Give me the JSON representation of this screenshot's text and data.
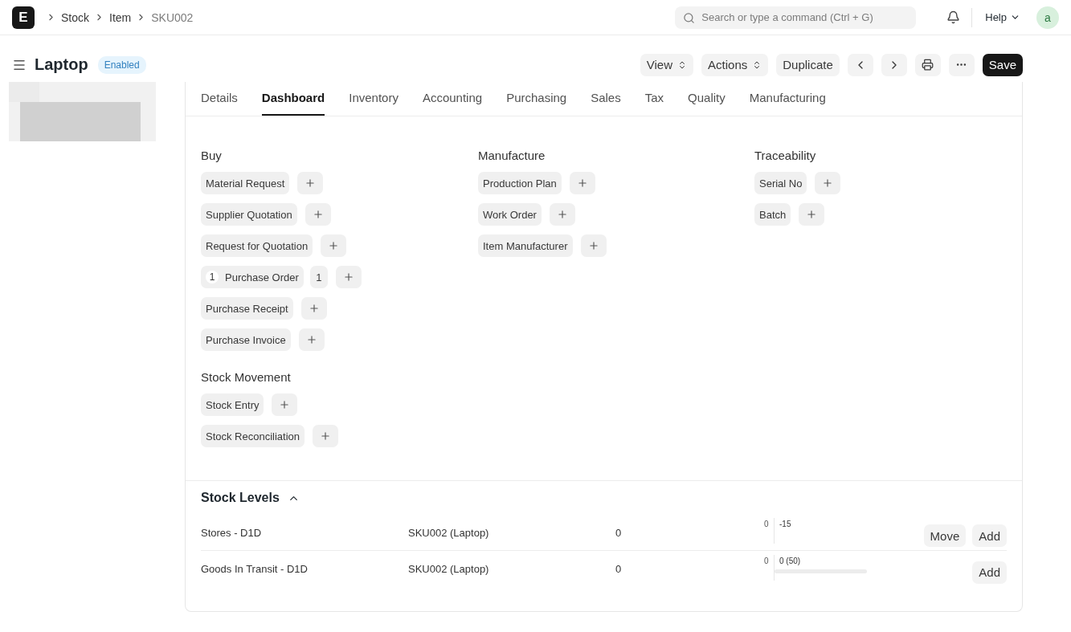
{
  "navbar": {
    "logo": "E",
    "breadcrumbs": [
      "Stock",
      "Item",
      "SKU002"
    ],
    "search": {
      "placeholder": "Search or type a command (Ctrl + G)"
    },
    "help": "Help",
    "avatar": "a"
  },
  "header": {
    "title": "Laptop",
    "status": "Enabled",
    "actions": [
      {
        "kind": "select",
        "label": "View"
      },
      {
        "kind": "select",
        "label": "Actions"
      },
      {
        "kind": "text",
        "label": "Duplicate"
      },
      {
        "kind": "prev"
      },
      {
        "kind": "next"
      },
      {
        "kind": "print"
      },
      {
        "kind": "more"
      },
      {
        "kind": "primary",
        "label": "Save"
      }
    ]
  },
  "tabs": [
    {
      "label": "Details",
      "selected": false
    },
    {
      "label": "Dashboard",
      "selected": true
    },
    {
      "label": "Inventory",
      "selected": false
    },
    {
      "label": "Accounting",
      "selected": false
    },
    {
      "label": "Purchasing",
      "selected": false
    },
    {
      "label": "Sales",
      "selected": false
    },
    {
      "label": "Tax",
      "selected": false
    },
    {
      "label": "Quality",
      "selected": false
    },
    {
      "label": "Manufacturing",
      "selected": false
    }
  ],
  "link_columns": [
    [
      {
        "title": "Buy",
        "items": [
          {
            "label": "Material Request"
          },
          {
            "label": "Supplier Quotation"
          },
          {
            "label": "Request for Quotation"
          },
          {
            "label": "Purchase Order",
            "count": "1",
            "open_count": "1"
          },
          {
            "label": "Purchase Receipt"
          },
          {
            "label": "Purchase Invoice"
          }
        ]
      },
      {
        "title": "Stock Movement",
        "items": [
          {
            "label": "Stock Entry"
          },
          {
            "label": "Stock Reconciliation"
          }
        ]
      }
    ],
    [
      {
        "title": "Manufacture",
        "items": [
          {
            "label": "Production Plan"
          },
          {
            "label": "Work Order"
          },
          {
            "label": "Item Manufacturer"
          }
        ]
      }
    ],
    [
      {
        "title": "Traceability",
        "items": [
          {
            "label": "Serial No"
          },
          {
            "label": "Batch"
          }
        ]
      }
    ]
  ],
  "stock_levels": {
    "title": "Stock Levels",
    "expanded": true,
    "rows": [
      {
        "warehouse": "Stores - D1D",
        "item": "SKU002 (Laptop)",
        "qty": "0",
        "zero": "0",
        "reading": "-15",
        "buttons": [
          "Move",
          "Add"
        ]
      },
      {
        "warehouse": "Goods In Transit - D1D",
        "item": "SKU002 (Laptop)",
        "qty": "0",
        "zero": "0",
        "reading": "0 (50)",
        "level": 0,
        "buttons": [
          "Add"
        ]
      }
    ]
  }
}
